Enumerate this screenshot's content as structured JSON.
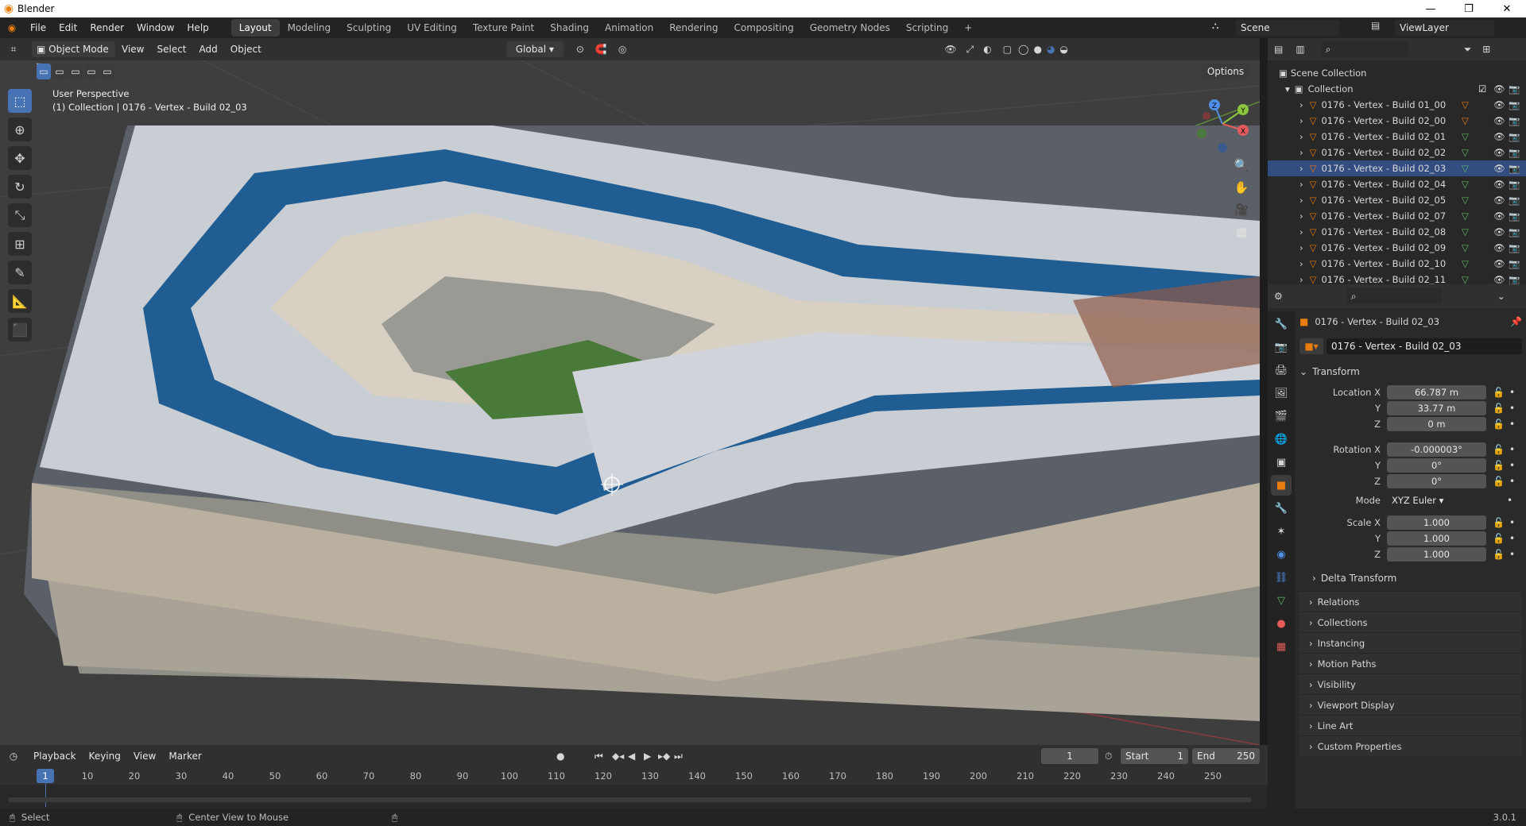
{
  "app": {
    "title": "Blender",
    "version": "3.0.1"
  },
  "menus": [
    "File",
    "Edit",
    "Render",
    "Window",
    "Help"
  ],
  "workspaces": [
    {
      "label": "Layout",
      "active": true
    },
    {
      "label": "Modeling"
    },
    {
      "label": "Sculpting"
    },
    {
      "label": "UV Editing"
    },
    {
      "label": "Texture Paint"
    },
    {
      "label": "Shading"
    },
    {
      "label": "Animation"
    },
    {
      "label": "Rendering"
    },
    {
      "label": "Compositing"
    },
    {
      "label": "Geometry Nodes"
    },
    {
      "label": "Scripting"
    }
  ],
  "scene": {
    "name": "Scene",
    "view_layer": "ViewLayer"
  },
  "viewport": {
    "mode": "Object Mode",
    "menus": [
      "View",
      "Select",
      "Add",
      "Object"
    ],
    "transform_orientation": "Global",
    "options_label": "Options",
    "overlay_line1": "User Perspective",
    "overlay_line2": "(1) Collection | 0176 - Vertex - Build 02_03",
    "gizmo": {
      "x": "X",
      "y": "Y",
      "z": "Z"
    }
  },
  "outliner": {
    "scene_collection": "Scene Collection",
    "collection": "Collection",
    "items": [
      "0176 - Vertex - Build 01_00",
      "0176 - Vertex - Build 02_00",
      "0176 - Vertex - Build 02_01",
      "0176 - Vertex - Build 02_02",
      "0176 - Vertex - Build 02_03",
      "0176 - Vertex - Build 02_04",
      "0176 - Vertex - Build 02_05",
      "0176 - Vertex - Build 02_07",
      "0176 - Vertex - Build 02_08",
      "0176 - Vertex - Build 02_09",
      "0176 - Vertex - Build 02_10",
      "0176 - Vertex - Build 02_11"
    ]
  },
  "properties": {
    "object_name": "0176 - Vertex - Build 02_03",
    "datablock": "0176 - Vertex - Build 02_03",
    "transform_label": "Transform",
    "location": {
      "label": "Location X",
      "x": "66.787 m",
      "y": "33.77 m",
      "z": "0 m"
    },
    "rotation": {
      "label": "Rotation X",
      "x": "-0.000003°",
      "y": "0°",
      "z": "0°"
    },
    "mode": {
      "label": "Mode",
      "value": "XYZ Euler"
    },
    "scale": {
      "label": "Scale X",
      "x": "1.000",
      "y": "1.000",
      "z": "1.000"
    },
    "axis_y": "Y",
    "axis_z": "Z",
    "delta": "Delta Transform",
    "panels": [
      "Relations",
      "Collections",
      "Instancing",
      "Motion Paths",
      "Visibility",
      "Viewport Display",
      "Line Art",
      "Custom Properties"
    ]
  },
  "timeline": {
    "menus": [
      "Playback",
      "Keying",
      "View",
      "Marker"
    ],
    "current_frame": "1",
    "start_label": "Start",
    "start": "1",
    "end_label": "End",
    "end": "250",
    "ticks": [
      "1",
      "10",
      "20",
      "30",
      "40",
      "50",
      "60",
      "70",
      "80",
      "90",
      "100",
      "110",
      "120",
      "130",
      "140",
      "150",
      "160",
      "170",
      "180",
      "190",
      "200",
      "210",
      "220",
      "230",
      "240",
      "250"
    ]
  },
  "status": {
    "select": "Select",
    "center": "Center View to Mouse",
    "version": "3.0.1"
  },
  "colors": {
    "accent": "#4772b3",
    "orange": "#e87d0d",
    "selected_row": "#334d80"
  }
}
